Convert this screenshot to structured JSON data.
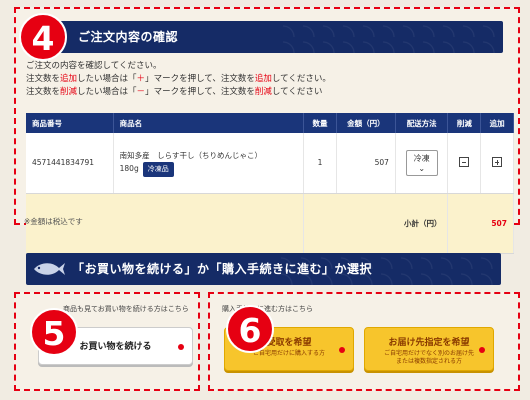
{
  "section4": {
    "number": "4",
    "title": "ご注文内容の確認",
    "intro_line1": "ご注文の内容を確認してください。",
    "intro_line2_pre": "注文数を",
    "intro_line2_add": "追加",
    "intro_line2_mid": "したい場合は「",
    "intro_line2_mark": "＋",
    "intro_line2_post": "」マークを押して、注文数を",
    "intro_line2_add2": "追加",
    "intro_line2_end": "してください。",
    "intro_line3_pre": "注文数を",
    "intro_line3_del": "削減",
    "intro_line3_mid": "したい場合は「",
    "intro_line3_mark": "－",
    "intro_line3_post": "」マークを押して、注文数を",
    "intro_line3_del2": "削減",
    "intro_line3_end": "してください",
    "columns": [
      "商品番号",
      "商品名",
      "数量",
      "金額（円）",
      "配送方法",
      "削減",
      "追加"
    ],
    "row": {
      "code": "4571441834791",
      "name": "南知多産　しらす干し（ちりめんじゃこ）180g",
      "badge": "冷凍品",
      "qty": "1",
      "price": "507",
      "delivery": "冷凍"
    },
    "subtotal_label": "小計（円）",
    "subtotal_value": "507",
    "note": "※金額は税込です"
  },
  "select": {
    "title": "「お買い物を続ける」か「購入手続きに進む」か選択"
  },
  "section5": {
    "number": "5",
    "caption": "商品も見てお買い物を続ける方はこちら",
    "button": "お買い物を続ける"
  },
  "section6": {
    "number": "6",
    "caption": "購入手続きに進む方はこちら",
    "btn1_main": "受取を希望",
    "btn1_sub": "ご自宅用だけに購入する方",
    "btn2_main": "お届け先指定を希望",
    "btn2_sub1": "ご自宅用だけでなく別のお届け先",
    "btn2_sub2": "または複数指定される方"
  },
  "colors": {
    "accent": "#e60012",
    "navy": "#152b66",
    "yellow": "#f7c52c"
  }
}
